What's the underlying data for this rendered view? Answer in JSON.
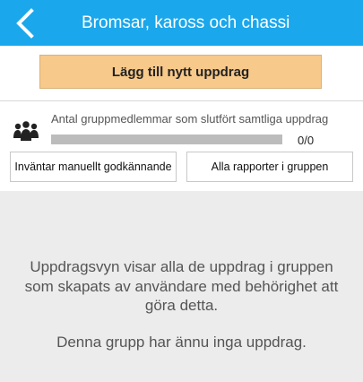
{
  "header": {
    "title": "Bromsar, kaross och chassi",
    "back_icon": "chevron-left-icon",
    "background": "#1aa7ec"
  },
  "actions": {
    "add_task_label": "Lägg till nytt uppdrag",
    "add_task_color": "#f7c98a"
  },
  "progress": {
    "icon": "group-icon",
    "label": "Antal gruppmedlemmar som slutfört samtliga uppdrag",
    "count_text": "0/0",
    "fraction": 0
  },
  "buttons": {
    "awaiting_approval": "Inväntar manuellt godkännande",
    "all_reports": "Alla rapporter i gruppen"
  },
  "empty_state": {
    "message": "Uppdragsvyn visar alla de uppdrag i gruppen som skapats av användare med behörighet att göra detta.",
    "no_tasks": "Denna grupp har ännu inga uppdrag."
  }
}
